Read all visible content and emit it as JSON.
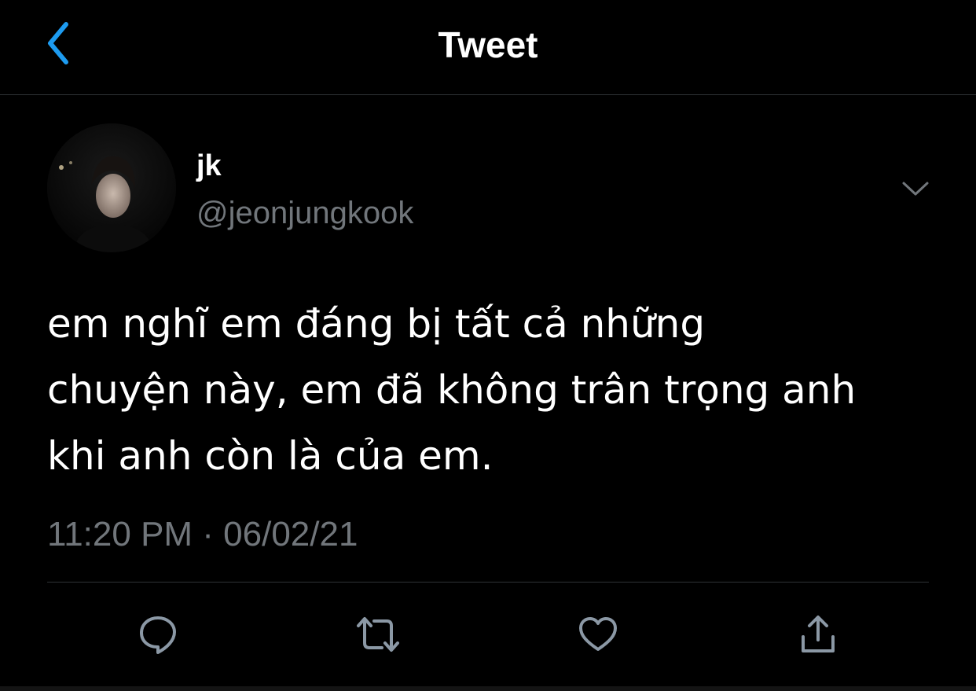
{
  "header": {
    "back_icon": "chevron-left-icon",
    "title": "Tweet"
  },
  "tweet": {
    "author": {
      "display_name": "jk",
      "handle": "@jeonjungkook"
    },
    "menu_icon": "chevron-down-icon",
    "text": "em nghĩ em đáng bị tất cả những\nchuyện này, em đã không trân trọng anh\nkhi anh còn là của em.",
    "timestamp": "11:20 PM · 06/02/21"
  },
  "actions": [
    {
      "icon": "reply-icon"
    },
    {
      "icon": "retweet-icon"
    },
    {
      "icon": "like-icon"
    },
    {
      "icon": "share-icon"
    }
  ],
  "colors": {
    "background": "#000000",
    "accent": "#1d9bf0",
    "secondary_text": "#71767b",
    "divider": "#2f3336",
    "icon": "#8b98a5"
  }
}
